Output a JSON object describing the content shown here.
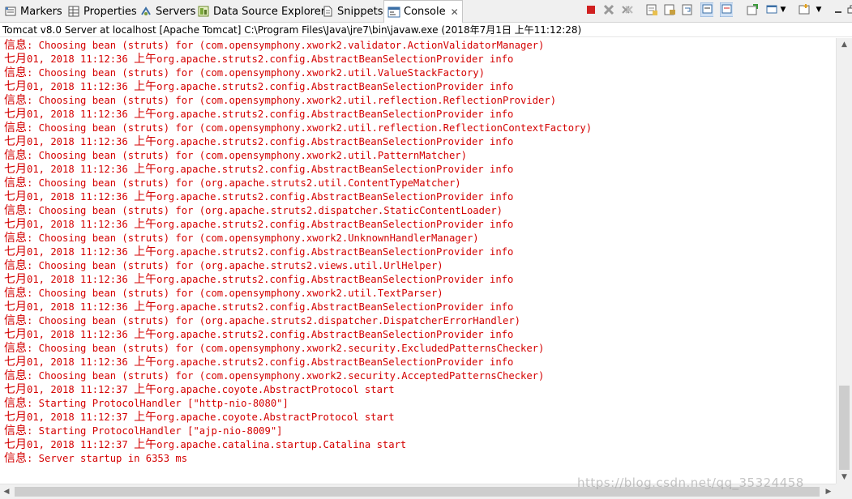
{
  "tabs": [
    {
      "label": "Markers",
      "icon": "markers-icon"
    },
    {
      "label": "Properties",
      "icon": "properties-icon"
    },
    {
      "label": "Servers",
      "icon": "servers-icon"
    },
    {
      "label": "Data Source Explorer",
      "icon": "data-source-icon"
    },
    {
      "label": "Snippets",
      "icon": "snippets-icon"
    },
    {
      "label": "Console",
      "icon": "console-icon",
      "active": true
    }
  ],
  "toolbar_icons": [
    "terminate-icon",
    "remove-launch-icon",
    "remove-all-icon",
    "clear-console-icon",
    "scroll-lock-icon",
    "word-wrap-icon",
    "show-stdout-icon",
    "show-stderr-icon",
    "pin-console-icon",
    "display-console-icon",
    "open-console-icon",
    "view-menu-icon",
    "minimize-icon",
    "maximize-icon"
  ],
  "subtitle": "Tomcat v8.0 Server at localhost [Apache Tomcat] C:\\Program Files\\Java\\jre7\\bin\\javaw.exe (2018年7月1日 上午11:12:28)",
  "console_color": "#d40000",
  "lines": [
    {
      "p": "信息",
      "t": ": Choosing bean (struts) for (com.opensymphony.xwork2.validator.ActionValidatorManager)"
    },
    {
      "p": "七月",
      "t": "01, 2018 11:12:36 ",
      "a": "上午",
      "b": "org.apache.struts2.config.AbstractBeanSelectionProvider info"
    },
    {
      "p": "信息",
      "t": ": Choosing bean (struts) for (com.opensymphony.xwork2.util.ValueStackFactory)"
    },
    {
      "p": "七月",
      "t": "01, 2018 11:12:36 ",
      "a": "上午",
      "b": "org.apache.struts2.config.AbstractBeanSelectionProvider info"
    },
    {
      "p": "信息",
      "t": ": Choosing bean (struts) for (com.opensymphony.xwork2.util.reflection.ReflectionProvider)"
    },
    {
      "p": "七月",
      "t": "01, 2018 11:12:36 ",
      "a": "上午",
      "b": "org.apache.struts2.config.AbstractBeanSelectionProvider info"
    },
    {
      "p": "信息",
      "t": ": Choosing bean (struts) for (com.opensymphony.xwork2.util.reflection.ReflectionContextFactory)"
    },
    {
      "p": "七月",
      "t": "01, 2018 11:12:36 ",
      "a": "上午",
      "b": "org.apache.struts2.config.AbstractBeanSelectionProvider info"
    },
    {
      "p": "信息",
      "t": ": Choosing bean (struts) for (com.opensymphony.xwork2.util.PatternMatcher)"
    },
    {
      "p": "七月",
      "t": "01, 2018 11:12:36 ",
      "a": "上午",
      "b": "org.apache.struts2.config.AbstractBeanSelectionProvider info"
    },
    {
      "p": "信息",
      "t": ": Choosing bean (struts) for (org.apache.struts2.util.ContentTypeMatcher)"
    },
    {
      "p": "七月",
      "t": "01, 2018 11:12:36 ",
      "a": "上午",
      "b": "org.apache.struts2.config.AbstractBeanSelectionProvider info"
    },
    {
      "p": "信息",
      "t": ": Choosing bean (struts) for (org.apache.struts2.dispatcher.StaticContentLoader)"
    },
    {
      "p": "七月",
      "t": "01, 2018 11:12:36 ",
      "a": "上午",
      "b": "org.apache.struts2.config.AbstractBeanSelectionProvider info"
    },
    {
      "p": "信息",
      "t": ": Choosing bean (struts) for (com.opensymphony.xwork2.UnknownHandlerManager)"
    },
    {
      "p": "七月",
      "t": "01, 2018 11:12:36 ",
      "a": "上午",
      "b": "org.apache.struts2.config.AbstractBeanSelectionProvider info"
    },
    {
      "p": "信息",
      "t": ": Choosing bean (struts) for (org.apache.struts2.views.util.UrlHelper)"
    },
    {
      "p": "七月",
      "t": "01, 2018 11:12:36 ",
      "a": "上午",
      "b": "org.apache.struts2.config.AbstractBeanSelectionProvider info"
    },
    {
      "p": "信息",
      "t": ": Choosing bean (struts) for (com.opensymphony.xwork2.util.TextParser)"
    },
    {
      "p": "七月",
      "t": "01, 2018 11:12:36 ",
      "a": "上午",
      "b": "org.apache.struts2.config.AbstractBeanSelectionProvider info"
    },
    {
      "p": "信息",
      "t": ": Choosing bean (struts) for (org.apache.struts2.dispatcher.DispatcherErrorHandler)"
    },
    {
      "p": "七月",
      "t": "01, 2018 11:12:36 ",
      "a": "上午",
      "b": "org.apache.struts2.config.AbstractBeanSelectionProvider info"
    },
    {
      "p": "信息",
      "t": ": Choosing bean (struts) for (com.opensymphony.xwork2.security.ExcludedPatternsChecker)"
    },
    {
      "p": "七月",
      "t": "01, 2018 11:12:36 ",
      "a": "上午",
      "b": "org.apache.struts2.config.AbstractBeanSelectionProvider info"
    },
    {
      "p": "信息",
      "t": ": Choosing bean (struts) for (com.opensymphony.xwork2.security.AcceptedPatternsChecker)"
    },
    {
      "p": "七月",
      "t": "01, 2018 11:12:37 ",
      "a": "上午",
      "b": "org.apache.coyote.AbstractProtocol start"
    },
    {
      "p": "信息",
      "t": ": Starting ProtocolHandler [\"http-nio-8080\"]"
    },
    {
      "p": "七月",
      "t": "01, 2018 11:12:37 ",
      "a": "上午",
      "b": "org.apache.coyote.AbstractProtocol start"
    },
    {
      "p": "信息",
      "t": ": Starting ProtocolHandler [\"ajp-nio-8009\"]"
    },
    {
      "p": "七月",
      "t": "01, 2018 11:12:37 ",
      "a": "上午",
      "b": "org.apache.catalina.startup.Catalina start"
    },
    {
      "p": "信息",
      "t": ": Server startup in 6353 ms"
    }
  ],
  "watermark": "https://blog.csdn.net/qq_35324458"
}
